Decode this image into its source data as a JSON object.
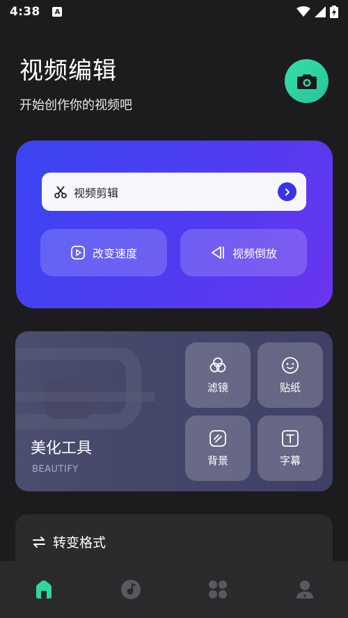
{
  "status_bar": {
    "time": "4:38",
    "notification_icon": "A",
    "icons": [
      "wifi-icon",
      "signal-icon",
      "battery-charging-icon"
    ]
  },
  "header": {
    "title": "视频编辑",
    "subtitle": "开始创作你的视频吧",
    "camera_icon": "camera-icon"
  },
  "edit_card": {
    "video_cut_label": "视频剪辑",
    "speed_label": "改变速度",
    "reverse_label": "视频倒放"
  },
  "beautify": {
    "title": "美化工具",
    "subtitle": "BEAUTIFY",
    "tools": [
      {
        "label": "滤镜",
        "icon": "filter-icon"
      },
      {
        "label": "贴纸",
        "icon": "sticker-icon"
      },
      {
        "label": "背景",
        "icon": "background-icon"
      },
      {
        "label": "字幕",
        "icon": "caption-icon"
      }
    ]
  },
  "format": {
    "label": "转变格式"
  },
  "bottom_nav": {
    "items": [
      "home-icon",
      "music-icon",
      "apps-icon",
      "profile-icon"
    ],
    "active": "home-icon"
  },
  "colors": {
    "background": "#1c1c1e",
    "accent_green": "#2fd6a0",
    "accent_blue": "#3b45f2",
    "accent_purple": "#6a35ee"
  }
}
